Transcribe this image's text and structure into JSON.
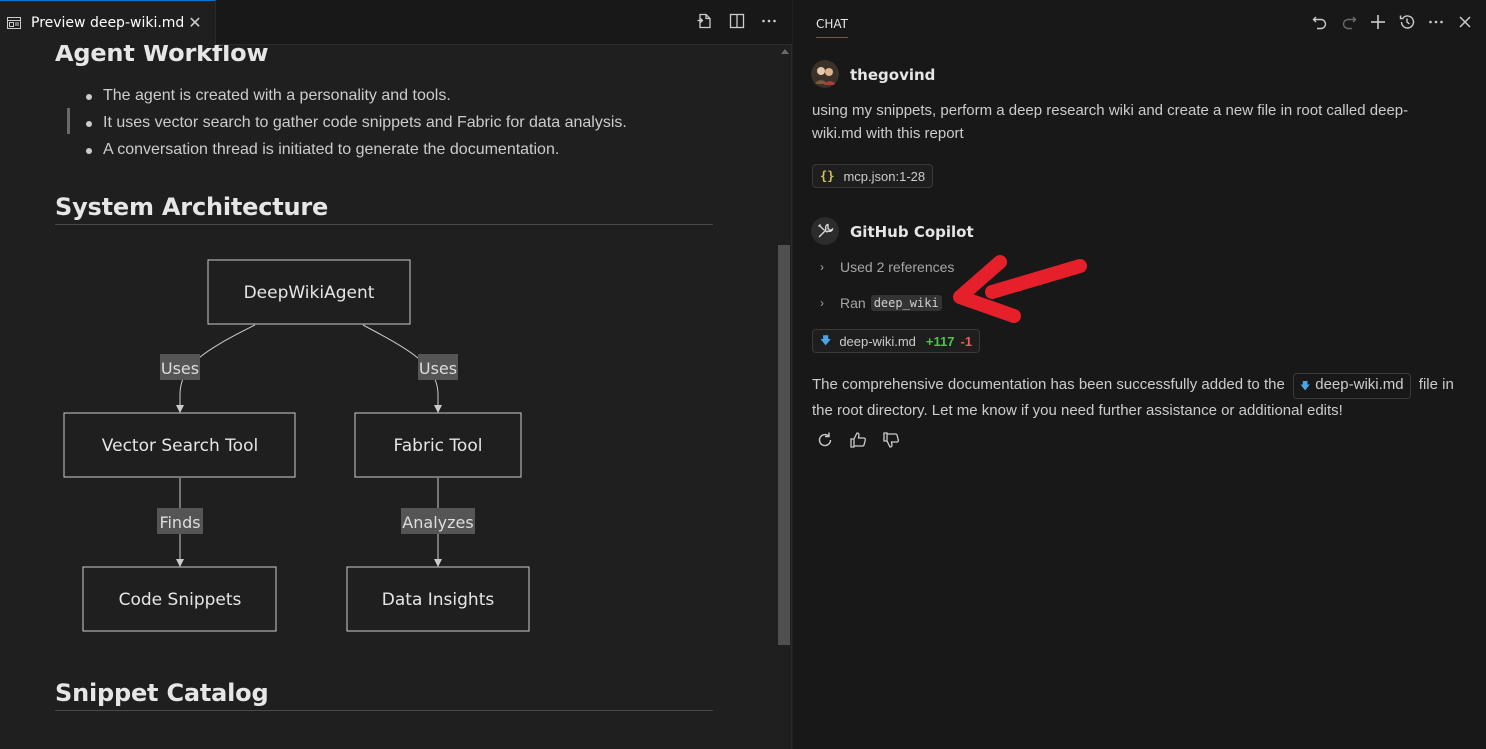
{
  "editor": {
    "tab": {
      "label": "Preview deep-wiki.md",
      "icon": "preview-icon",
      "close_icon": "close-icon"
    },
    "actions": [
      {
        "name": "open-source-icon"
      },
      {
        "name": "split-editor-icon"
      },
      {
        "name": "more-actions-icon"
      }
    ],
    "headings": {
      "agent_workflow": "Agent Workflow",
      "system_architecture": "System Architecture",
      "snippet_catalog": "Snippet Catalog"
    },
    "bullets": [
      "The agent is created with a personality and tools.",
      "It uses vector search to gather code snippets and Fabric for data analysis.",
      "A conversation thread is initiated to generate the documentation."
    ],
    "diagram": {
      "nodes": {
        "root": "DeepWikiAgent",
        "vector": "Vector Search Tool",
        "fabric": "Fabric Tool",
        "snippets": "Code Snippets",
        "insights": "Data Insights"
      },
      "edges": {
        "uses_left": "Uses",
        "uses_right": "Uses",
        "finds": "Finds",
        "analyzes": "Analyzes"
      }
    }
  },
  "chat": {
    "tab_label": "CHAT",
    "header_actions": [
      "undo-icon",
      "redo-icon",
      "new-chat-icon",
      "history-icon",
      "more-icon",
      "close-icon"
    ],
    "user": {
      "name": "thegovind",
      "message": "using my snippets, perform a deep research wiki and create a new file in root called deep-wiki.md with this report",
      "attachment": {
        "label": "mcp.json",
        "range": ":1-28"
      }
    },
    "assistant": {
      "name": "GitHub Copilot",
      "references_label": "Used 2 references",
      "ran_label": "Ran",
      "tool_name": "deep_wiki",
      "file_change": {
        "file": "deep-wiki.md",
        "added": "+117",
        "removed": "-1"
      },
      "response_before": "The comprehensive documentation has been successfully added to the",
      "response_file": "deep-wiki.md",
      "response_after": "file in the root directory. Let me know if you need further assistance or additional edits!"
    },
    "feedback_icons": [
      "retry-icon",
      "thumbs-up-icon",
      "thumbs-down-icon"
    ]
  },
  "colors": {
    "accent": "#0078d4",
    "annotation_arrow": "#e5202a",
    "added": "#4ec34e",
    "removed": "#f05a5a"
  }
}
